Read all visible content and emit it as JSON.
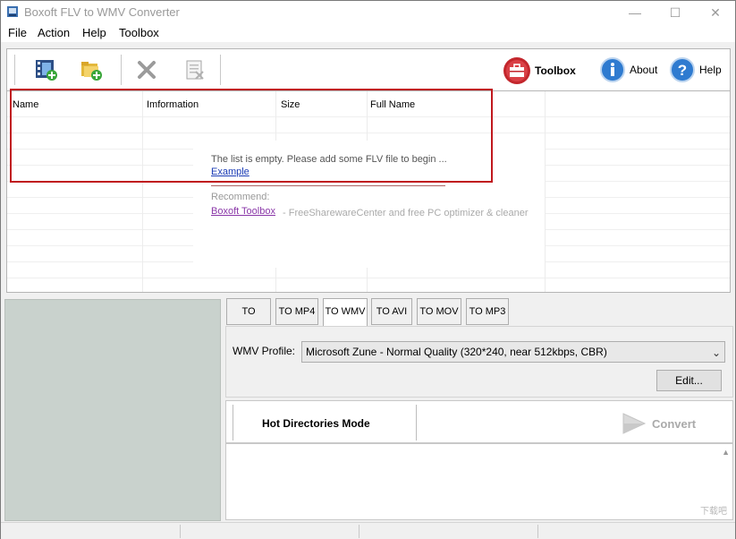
{
  "window": {
    "title": "Boxoft FLV to WMV Converter",
    "minimize": "—",
    "maximize": "☐",
    "close": "✕"
  },
  "menu": [
    "File",
    "Action",
    "Help",
    "Toolbox"
  ],
  "toolbar": {
    "toolbox_label": "Toolbox",
    "about_label": "About",
    "help_label": "Help"
  },
  "list": {
    "columns": [
      "Name",
      "Imformation",
      "Size",
      "Full Name"
    ],
    "empty_message": "The list is empty. Please add some FLV file to begin ...",
    "example_link": "Example",
    "recommend_label": "Recommend:",
    "toolbox_link": "Boxoft Toolbox",
    "toolbox_desc": "- FreeSharewareCenter and free PC optimizer & cleaner"
  },
  "tabs": [
    "TO MPEG",
    "TO MP4",
    "TO WMV",
    "TO AVI",
    "TO MOV",
    "TO MP3"
  ],
  "active_tab": "TO WMV",
  "profile": {
    "label": "WMV Profile:",
    "value": "Microsoft Zune - Normal Quality (320*240, near 512kbps, CBR)",
    "edit_button": "Edit..."
  },
  "hot_directories": {
    "label": "Hot Directories Mode",
    "convert_label": "Convert"
  },
  "watermark": "下载吧",
  "colors": {
    "highlight": "#c0181e",
    "preview_bg": "#c9d2cd",
    "link": "#1a3bb5",
    "toolbox_link": "#8a37a8"
  }
}
